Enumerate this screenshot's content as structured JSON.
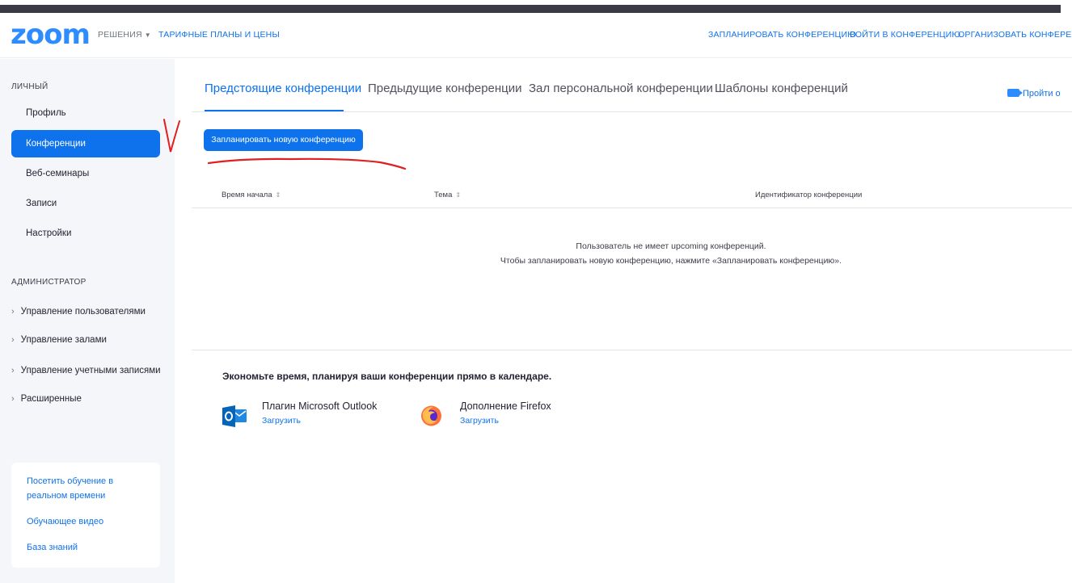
{
  "header": {
    "logo": "zoom",
    "solutions": "РЕШЕНИЯ",
    "pricing": "ТАРИФНЫЕ ПЛАНЫ И ЦЕНЫ",
    "schedule": "ЗАПЛАНИРОВАТЬ КОНФЕРЕНЦИЮ",
    "join": "ВОЙТИ В КОНФЕРЕНЦИЮ",
    "host": "ОРГАНИЗОВАТЬ КОНФЕРЕНЦ"
  },
  "sidebar": {
    "personal_section": "ЛИЧНЫЙ",
    "items": [
      {
        "label": "Профиль"
      },
      {
        "label": "Конференции"
      },
      {
        "label": "Веб-семинары"
      },
      {
        "label": "Записи"
      },
      {
        "label": "Настройки"
      }
    ],
    "admin_section": "АДМИНИСТРАТОР",
    "admin_items": [
      {
        "label": "Управление пользователями"
      },
      {
        "label": "Управление залами"
      },
      {
        "label": "Управление учетными записями"
      },
      {
        "label": "Расширенные"
      }
    ],
    "help": {
      "live_training": "Посетить обучение в реальном времени",
      "video": "Обучающее видео",
      "knowledge_base": "База знаний"
    }
  },
  "main": {
    "tabs": [
      {
        "label": "Предстоящие конференции"
      },
      {
        "label": "Предыдущие конференции"
      },
      {
        "label": "Зал персональной конференции"
      },
      {
        "label": "Шаблоны конференций"
      }
    ],
    "join_link": "Пройти о",
    "schedule_button": "Запланировать новую конференцию",
    "table_headers": {
      "start_time": "Время начала",
      "topic": "Тема",
      "meeting_id": "Идентификатор конференции"
    },
    "empty_line1": "Пользователь не имеет upcoming конференций.",
    "empty_line2": "Чтобы запланировать новую конференцию, нажмите «Запланировать конференцию».",
    "promo_title": "Экономьте время, планируя ваши конференции прямо в календаре.",
    "plugins": [
      {
        "name": "Плагин Microsoft Outlook",
        "link": "Загрузить",
        "icon": "outlook-icon"
      },
      {
        "name": "Дополнение Firefox",
        "link": "Загрузить",
        "icon": "firefox-icon"
      }
    ]
  },
  "colors": {
    "accent": "#0e72ed",
    "logo": "#2d8cff",
    "annotation": "#e02020"
  }
}
